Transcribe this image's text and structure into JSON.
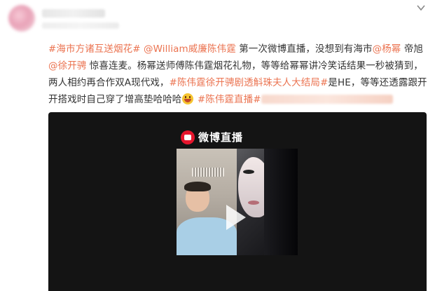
{
  "post": {
    "segments": [
      {
        "type": "topic",
        "text": "#海市方诸互送烟花#"
      },
      {
        "type": "text",
        "text": " "
      },
      {
        "type": "mention",
        "text": "@William威廉陈伟霆"
      },
      {
        "type": "text",
        "text": " 第一次微博直播，没想到有海市"
      },
      {
        "type": "mention",
        "text": "@杨幂"
      },
      {
        "type": "text",
        "text": " 帝旭"
      },
      {
        "type": "mention",
        "text": "@徐开骋"
      },
      {
        "type": "text",
        "text": " 惊喜连麦。杨幂送师傅陈伟霆烟花礼物，等等给幂幂讲冷笑话结果一秒被猜到，两人相约再合作双A现代戏，"
      },
      {
        "type": "topic",
        "text": "#陈伟霆徐开骋剧透斛珠夫人大结局#"
      },
      {
        "type": "text",
        "text": "是HE，等等还透露跟开开搭戏时自己穿了增高垫哈哈哈"
      },
      {
        "type": "emoji",
        "text": ""
      },
      {
        "type": "text",
        "text": " "
      },
      {
        "type": "topic",
        "text": "#陈伟霆直播#"
      }
    ]
  },
  "video": {
    "brand": "微博直播",
    "brand_icon": "weibo-live-logo-icon",
    "play_icon": "play-icon"
  },
  "header": {
    "menu_icon": "chevron-down-icon"
  },
  "colors": {
    "link": "#eb7350",
    "text": "#333333",
    "video_bg": "#141414"
  }
}
